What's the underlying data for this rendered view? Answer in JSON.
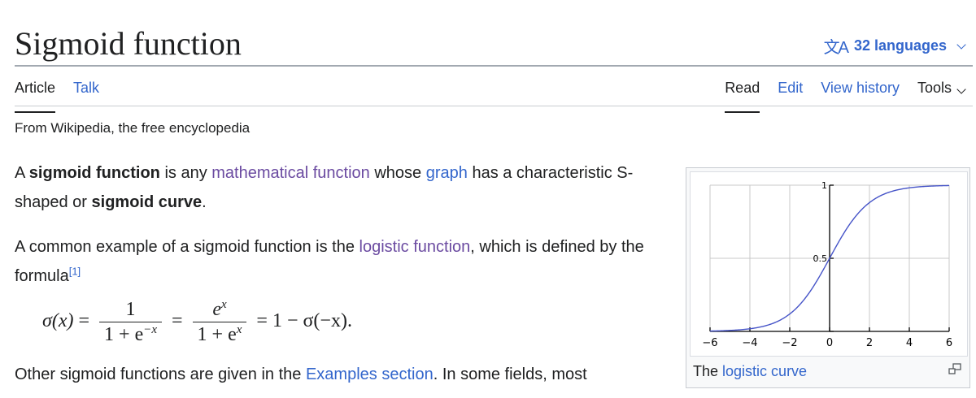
{
  "title": "Sigmoid function",
  "languages": {
    "label": "32 languages",
    "icon": "translate-icon"
  },
  "tabs_left": [
    "Article",
    "Talk"
  ],
  "tabs_right": [
    "Read",
    "Edit",
    "View history",
    "Tools"
  ],
  "tagline": "From Wikipedia, the free encyclopedia",
  "p1": {
    "t1": "A ",
    "b1": "sigmoid function",
    "t2": " is any ",
    "l1": "mathematical function",
    "t3": " whose ",
    "l2": "graph",
    "t4": " has a characteristic S-shaped or ",
    "b2": "sigmoid curve",
    "t5": "."
  },
  "p2": {
    "t1": "A common example of a sigmoid function is the ",
    "l1": "logistic function",
    "t2": ", which is defined by the formula",
    "ref": "[1]"
  },
  "formula": {
    "lhs": "σ(x)",
    "eq": "=",
    "num1": "1",
    "den1": "1 + e",
    "exp1": "−x",
    "num2": "e",
    "exp2": "x",
    "den2": "1 + e",
    "exp3": "x",
    "rhs": "1 − σ(−x)."
  },
  "p3": {
    "t1": "Other sigmoid functions are given in the ",
    "l1": "Examples section",
    "t2": ". In some fields, most"
  },
  "figure": {
    "caption_text": "The ",
    "caption_link": "logistic curve",
    "magnify_icon": "magnify-icon"
  },
  "chart_data": {
    "type": "line",
    "function": "logistic",
    "x_ticks": [
      "−6",
      "−4",
      "−2",
      "0",
      "2",
      "4",
      "6"
    ],
    "y_ticks": [
      "0",
      "0.5",
      "1"
    ],
    "xlim": [
      -6,
      6
    ],
    "ylim": [
      0,
      1
    ],
    "grid": true,
    "series": [
      {
        "color": "#4654c8",
        "x": [
          -6,
          -5,
          -4,
          -3,
          -2,
          -1,
          0,
          1,
          2,
          3,
          4,
          5,
          6
        ],
        "y": [
          0.0025,
          0.0067,
          0.018,
          0.047,
          0.119,
          0.269,
          0.5,
          0.731,
          0.881,
          0.953,
          0.982,
          0.9933,
          0.9975
        ]
      }
    ]
  }
}
